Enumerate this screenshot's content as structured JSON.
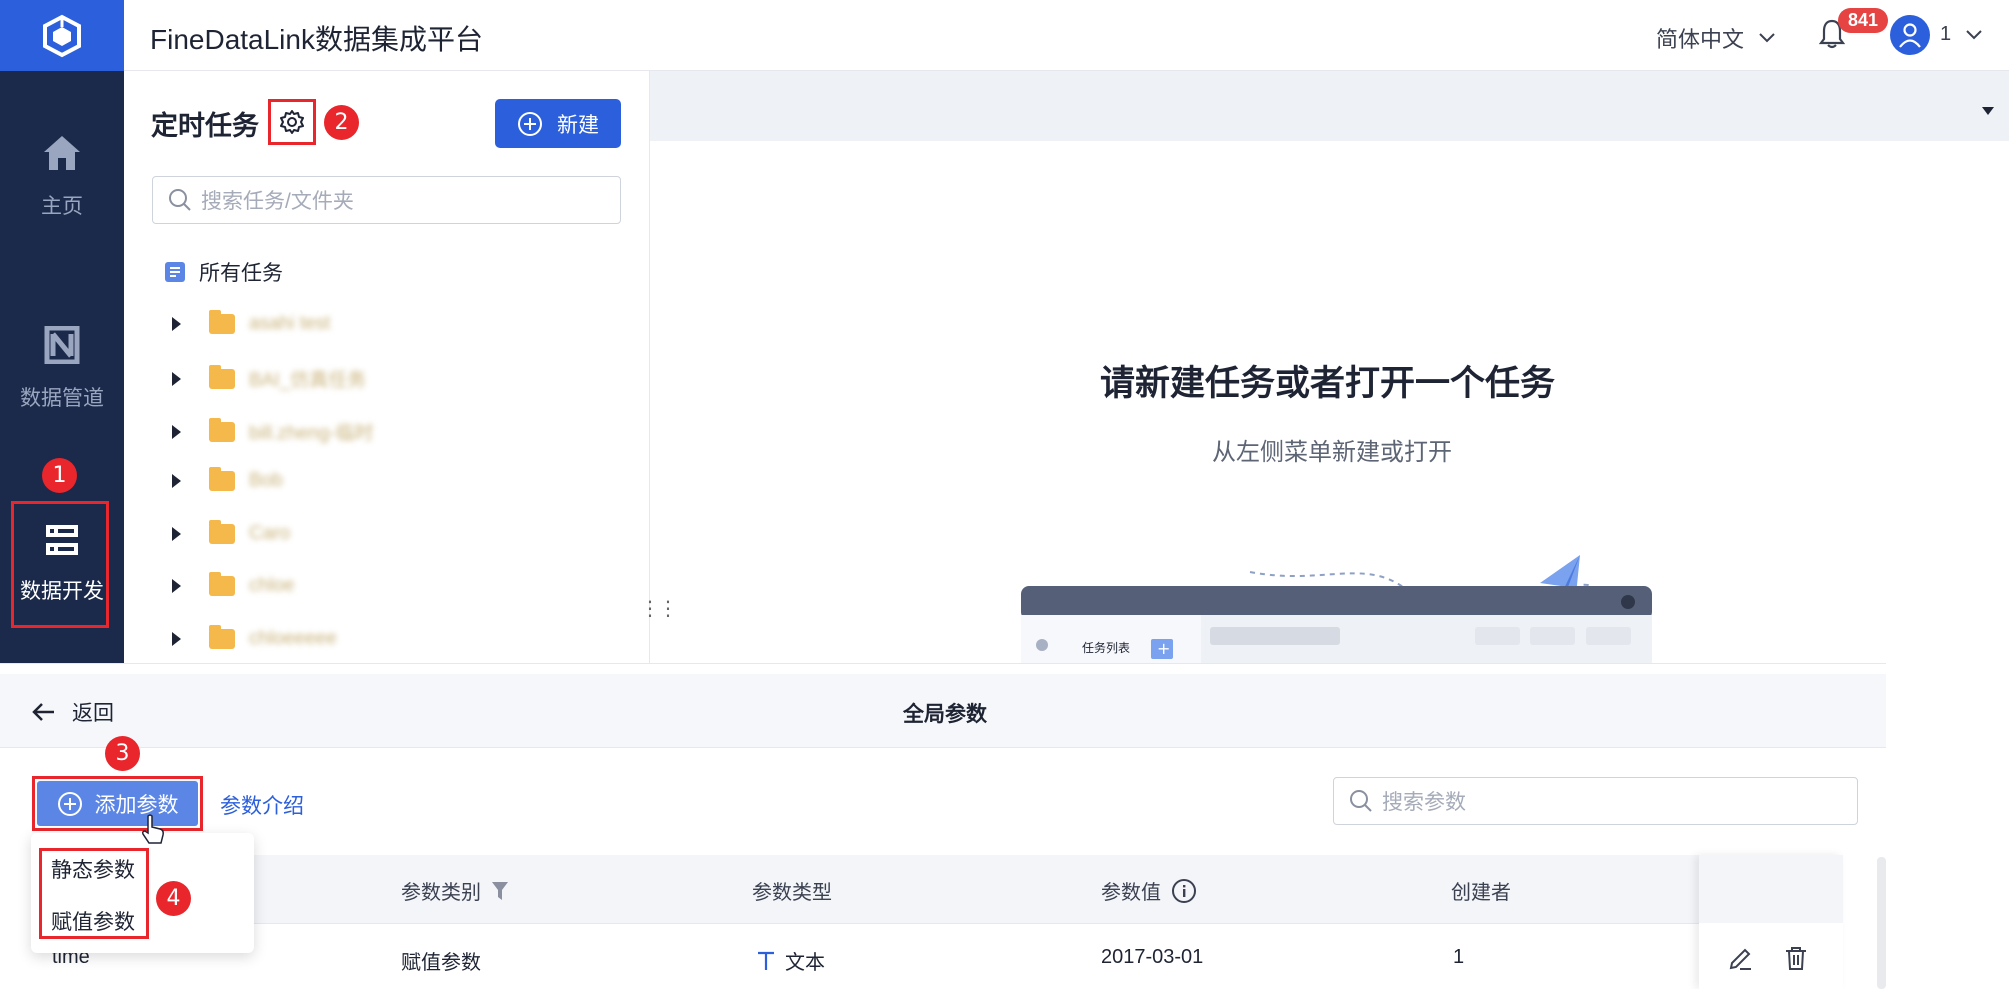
{
  "app": {
    "title": "FineDataLink数据集成平台"
  },
  "header": {
    "language": "简体中文",
    "notification_count": "841",
    "user": "1"
  },
  "nav": {
    "items": [
      {
        "label": "主页",
        "icon": "home-icon"
      },
      {
        "label": "数据管道",
        "icon": "pipeline-icon"
      },
      {
        "label": "数据开发",
        "icon": "server-icon",
        "active": true
      }
    ]
  },
  "tasks": {
    "title": "定时任务",
    "new_button": "新建",
    "search_placeholder": "搜索任务/文件夹",
    "all_tasks": "所有任务",
    "folders": [
      "asahi test",
      "BAI_仿真任务",
      "bill.zheng-临时",
      "Bob",
      "Caro",
      "chloe",
      "chloeeeee"
    ]
  },
  "empty_state": {
    "title": "请新建任务或者打开一个任务",
    "subtitle": "从左侧菜单新建或打开",
    "illustration_label": "任务列表"
  },
  "global_params": {
    "back": "返回",
    "title": "全局参数",
    "add_button": "添加参数",
    "intro_link": "参数介绍",
    "search_placeholder": "搜索参数",
    "columns": [
      "参数类别",
      "参数类型",
      "参数值",
      "创建者"
    ],
    "rows": [
      {
        "name": "time",
        "category": "赋值参数",
        "type": "文本",
        "value": "2017-03-01",
        "creator": "1"
      }
    ],
    "dropdown": [
      "静态参数",
      "赋值参数"
    ]
  },
  "markers": [
    "1",
    "2",
    "3",
    "4"
  ],
  "colors": {
    "brand": "#2c5fdb",
    "nav_bg": "#1b2a4b",
    "highlight": "#e8262c",
    "badge": "#e64343"
  }
}
